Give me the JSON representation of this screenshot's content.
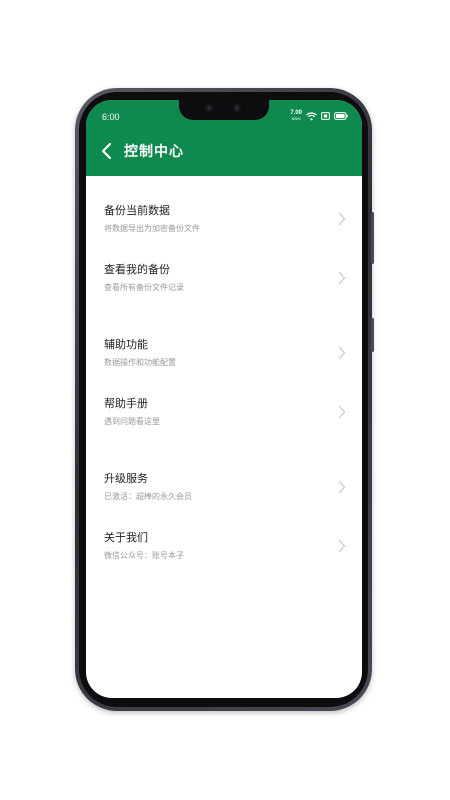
{
  "status_bar": {
    "time": "6:00",
    "net_speed_value": "7.00",
    "net_speed_unit": "KB/S",
    "icons": [
      "wifi-icon",
      "sim-icon",
      "battery-icon"
    ]
  },
  "header": {
    "title": "控制中心",
    "back_icon": "chevron-left-icon"
  },
  "menu": [
    {
      "title": "备份当前数据",
      "subtitle": "将数据导出为加密备份文件"
    },
    {
      "title": "查看我的备份",
      "subtitle": "查看所有备份文件记录"
    },
    {
      "title": "辅助功能",
      "subtitle": "数据操作和功能配置"
    },
    {
      "title": "帮助手册",
      "subtitle": "遇到问题看这里"
    },
    {
      "title": "升级服务",
      "subtitle": "已激活：超棒的永久会员"
    },
    {
      "title": "关于我们",
      "subtitle": "微信公众号：账号本子"
    }
  ],
  "colors": {
    "header": "#0f8a4e",
    "title_text": "#222222",
    "subtitle_text": "#9a9a9a",
    "chevron": "#c8c8c8"
  }
}
